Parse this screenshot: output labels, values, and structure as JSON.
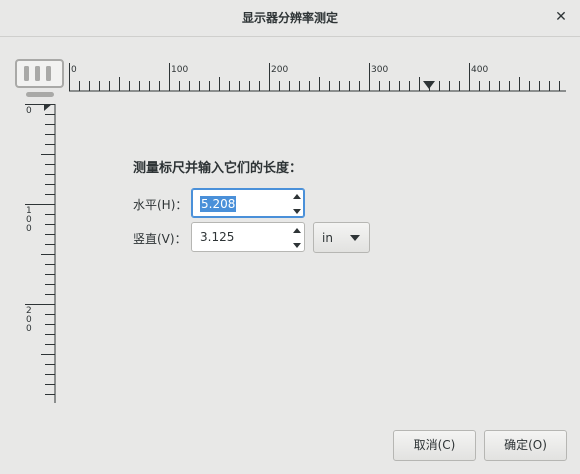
{
  "window": {
    "title": "显示器分辨率测定",
    "close_glyph": "✕"
  },
  "ruler": {
    "horizontal_labels": [
      "0",
      "100",
      "200",
      "300",
      "400"
    ],
    "vertical_labels": [
      "0",
      "100",
      "200"
    ]
  },
  "prompt": "测量标尺并输入它们的长度：",
  "horizontal": {
    "label": "水平(H)：",
    "value": "5.208"
  },
  "vertical": {
    "label": "竖直(V)：",
    "value": "3.125"
  },
  "unit": {
    "selected": "in"
  },
  "buttons": {
    "cancel": "取消(C)",
    "ok": "确定(O)"
  },
  "icons": {
    "monitor": "monitor-icon",
    "close": "close-icon"
  }
}
